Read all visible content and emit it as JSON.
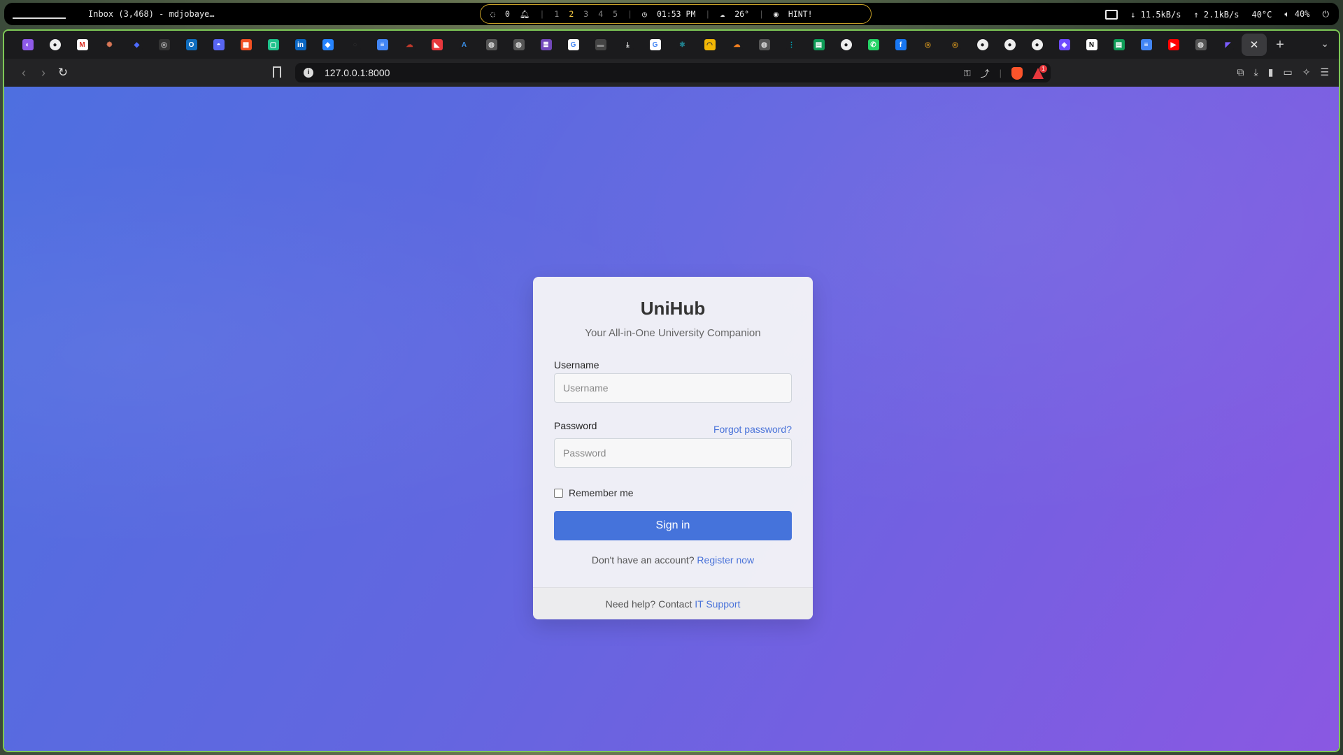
{
  "statusbar": {
    "window_title": "Inbox (3,468) - mdjobaye…",
    "notifications": "0",
    "workspaces": [
      "1",
      "2",
      "3",
      "4",
      "5"
    ],
    "active_workspace": "2",
    "clock": "01:53 PM",
    "weather": "26°",
    "hint": "HINT!",
    "net_down": "11.5kB/s",
    "net_up": "2.1kB/s",
    "temp": "40°C",
    "volume": "40%"
  },
  "browser": {
    "url": "127.0.0.1:8000",
    "new_tab": "+",
    "close_tab": "✕",
    "brave_badge_count": "1",
    "pinned_tab_icons": [
      "firefox-icon",
      "github-icon",
      "gmail-icon",
      "claude-icon",
      "deepseek-icon",
      "chatgpt-icon",
      "outlook-icon",
      "discord-icon",
      "microsoft-icon",
      "app-icon",
      "linkedin-icon",
      "jira-icon",
      "circle-icon",
      "docs-icon",
      "cloud-icon",
      "pdf-icon",
      "azure-icon",
      "globe-icon",
      "globe-icon",
      "forms-icon",
      "google-icon",
      "tab-icon",
      "download-icon",
      "google-icon",
      "perplexity-icon",
      "copilot-icon",
      "cloudflare-icon",
      "globe-icon",
      "tailscale-icon",
      "sheets-icon",
      "github-icon",
      "whatsapp-icon",
      "facebook-icon",
      "pocket-icon",
      "pocket-icon",
      "github-icon",
      "github-icon",
      "github-icon",
      "proton-icon",
      "notion-icon",
      "sheets-icon",
      "docs-icon",
      "youtube-icon",
      "globe-icon",
      "vscode-icon"
    ]
  },
  "login": {
    "brand": "UniHub",
    "tagline": "Your All-in-One University Companion",
    "username_label": "Username",
    "username_placeholder": "Username",
    "password_label": "Password",
    "password_placeholder": "Password",
    "forgot_link": "Forgot password?",
    "remember_label": "Remember me",
    "signin_label": "Sign in",
    "register_prompt": "Don't have an account?",
    "register_link": "Register now",
    "help_prompt": "Need help? Contact",
    "help_link": "IT Support"
  },
  "colors": {
    "accent": "#4573db",
    "link": "#4a73d9",
    "page_gradient_start": "#4e6fe0",
    "page_gradient_end": "#8a58e2",
    "window_border": "#7ec856",
    "statusbar_highlight": "#c9a227"
  }
}
